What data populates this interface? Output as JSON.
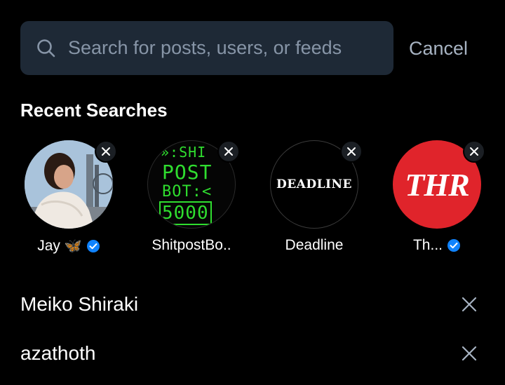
{
  "search": {
    "placeholder": "Search for posts, users, or feeds",
    "value": "",
    "cancel_label": "Cancel"
  },
  "recent": {
    "title": "Recent Searches",
    "profiles": [
      {
        "name": "Jay",
        "emoji": "🦋",
        "verified": true,
        "avatar": "photo-avatar"
      },
      {
        "name": "ShitpostBo..",
        "verified": false,
        "avatar_lines": [
          "»:SHI",
          "POST",
          "BOT:<",
          "5000"
        ]
      },
      {
        "name": "Deadline",
        "verified": false,
        "avatar_text": "DEADLINE"
      },
      {
        "name": "Th...",
        "verified": true,
        "avatar_text": "THR"
      }
    ],
    "queries": [
      {
        "label": "Meiko Shiraki"
      },
      {
        "label": "azathoth"
      }
    ]
  },
  "colors": {
    "background": "#000000",
    "search_bg": "#1e2936",
    "placeholder": "#8795a7",
    "cancel": "#a7b3c2",
    "verified": "#1083fe",
    "thr_red": "#e0242b",
    "terminal_green": "#2fdd2f"
  },
  "icons": {
    "search": "search-icon",
    "remove": "close-icon",
    "verified": "verified-check-icon"
  }
}
